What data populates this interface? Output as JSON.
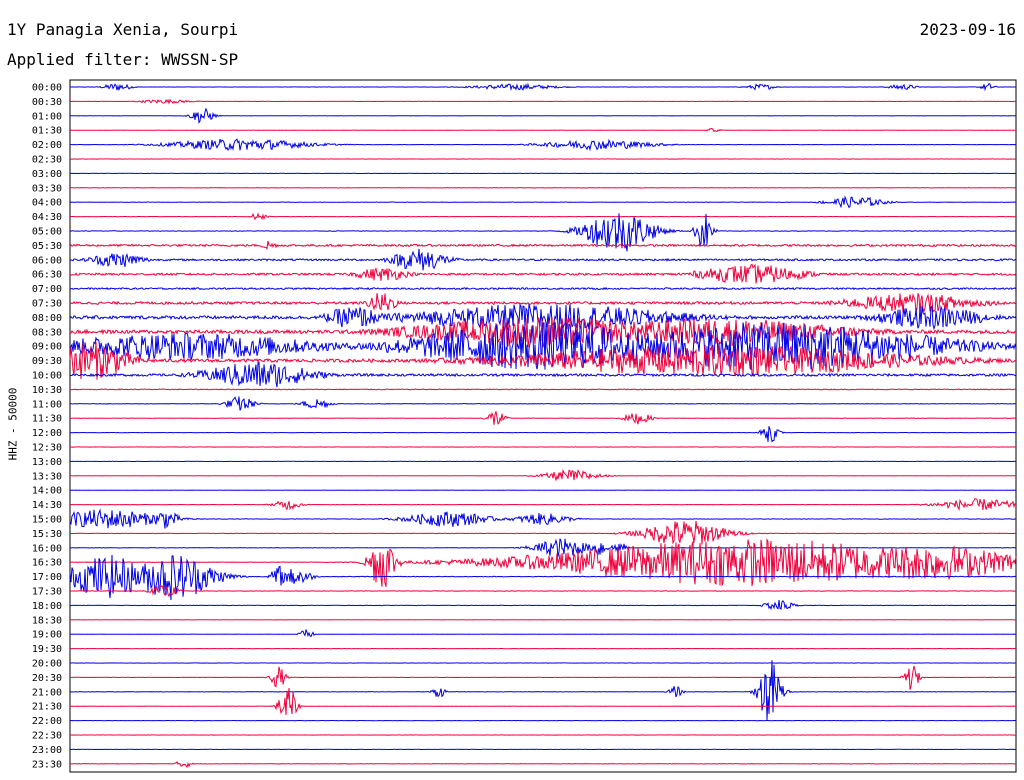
{
  "header": {
    "station": "1Y Panagia Xenia, Sourpi",
    "date": "2023-09-16",
    "filter": "Applied filter: WWSSN-SP"
  },
  "chart_data": {
    "type": "line",
    "subtype": "helicorder",
    "ylabel": "HHZ - 50000",
    "colors": [
      "#0000e6",
      "#f0003c"
    ],
    "row_labels": [
      "00:00",
      "00:30",
      "01:00",
      "01:30",
      "02:00",
      "02:30",
      "03:00",
      "03:30",
      "04:00",
      "04:30",
      "05:00",
      "05:30",
      "06:00",
      "06:30",
      "07:00",
      "07:30",
      "08:00",
      "08:30",
      "09:00",
      "09:30",
      "10:00",
      "10:30",
      "11:00",
      "11:30",
      "12:00",
      "12:30",
      "13:00",
      "13:30",
      "14:00",
      "14:30",
      "15:00",
      "15:30",
      "16:00",
      "16:30",
      "17:00",
      "17:30",
      "18:00",
      "18:30",
      "19:00",
      "19:30",
      "20:00",
      "20:30",
      "21:00",
      "21:30",
      "22:00",
      "22:30",
      "23:00",
      "23:30"
    ],
    "noise": [
      0.12,
      0.08,
      0.12,
      0.08,
      0.15,
      0.1,
      0.12,
      0.2,
      0.2,
      0.15,
      0.25,
      1.0,
      0.9,
      1.0,
      0.8,
      1.3,
      1.6,
      1.8,
      2.0,
      1.6,
      1.2,
      0.4,
      0.25,
      0.18,
      0.12,
      0.1,
      0.15,
      0.12,
      0.1,
      0.12,
      0.2,
      0.2,
      0.2,
      0.2,
      0.3,
      0.2,
      0.2,
      0.15,
      0.1,
      0.12,
      0.15,
      0.12,
      0.2,
      0.1,
      0.12,
      0.1,
      0.15,
      0.2
    ],
    "events": [
      {
        "row": 0,
        "x": 0.05,
        "amp": 4,
        "width": 0.01
      },
      {
        "row": 0,
        "x": 0.47,
        "amp": 3,
        "width": 0.03
      },
      {
        "row": 0,
        "x": 0.73,
        "amp": 3,
        "width": 0.01
      },
      {
        "row": 0,
        "x": 0.88,
        "amp": 3,
        "width": 0.01
      },
      {
        "row": 0,
        "x": 0.97,
        "amp": 4,
        "width": 0.005
      },
      {
        "row": 1,
        "x": 0.1,
        "amp": 2,
        "width": 0.02
      },
      {
        "row": 2,
        "x": 0.14,
        "amp": 8,
        "width": 0.008
      },
      {
        "row": 3,
        "x": 0.68,
        "amp": 2,
        "width": 0.005
      },
      {
        "row": 4,
        "x": 0.18,
        "amp": 6,
        "width": 0.05
      },
      {
        "row": 4,
        "x": 0.56,
        "amp": 5,
        "width": 0.04
      },
      {
        "row": 8,
        "x": 0.83,
        "amp": 6,
        "width": 0.02
      },
      {
        "row": 9,
        "x": 0.2,
        "amp": 6,
        "width": 0.005
      },
      {
        "row": 10,
        "x": 0.58,
        "amp": 22,
        "width": 0.025
      },
      {
        "row": 10,
        "x": 0.67,
        "amp": 20,
        "width": 0.006
      },
      {
        "row": 11,
        "x": 0.21,
        "amp": 6,
        "width": 0.005
      },
      {
        "row": 12,
        "x": 0.05,
        "amp": 8,
        "width": 0.02
      },
      {
        "row": 12,
        "x": 0.37,
        "amp": 12,
        "width": 0.02
      },
      {
        "row": 13,
        "x": 0.33,
        "amp": 7,
        "width": 0.02
      },
      {
        "row": 13,
        "x": 0.72,
        "amp": 10,
        "width": 0.04
      },
      {
        "row": 15,
        "x": 0.33,
        "amp": 12,
        "width": 0.01
      },
      {
        "row": 15,
        "x": 0.89,
        "amp": 10,
        "width": 0.05
      },
      {
        "row": 16,
        "x": 0.3,
        "amp": 12,
        "width": 0.02
      },
      {
        "row": 16,
        "x": 0.5,
        "amp": 14,
        "width": 0.1
      },
      {
        "row": 16,
        "x": 0.91,
        "amp": 12,
        "width": 0.04
      },
      {
        "row": 17,
        "x": 0.5,
        "amp": 16,
        "width": 0.1
      },
      {
        "row": 17,
        "x": 0.68,
        "amp": 14,
        "width": 0.1
      },
      {
        "row": 18,
        "x": 0.12,
        "amp": 14,
        "width": 0.1
      },
      {
        "row": 18,
        "x": 0.5,
        "amp": 25,
        "width": 0.1
      },
      {
        "row": 18,
        "x": 0.75,
        "amp": 25,
        "width": 0.12
      },
      {
        "row": 19,
        "x": 0.02,
        "amp": 20,
        "width": 0.03
      },
      {
        "row": 19,
        "x": 0.68,
        "amp": 16,
        "width": 0.15
      },
      {
        "row": 20,
        "x": 0.2,
        "amp": 14,
        "width": 0.04
      },
      {
        "row": 22,
        "x": 0.18,
        "amp": 8,
        "width": 0.01
      },
      {
        "row": 22,
        "x": 0.26,
        "amp": 6,
        "width": 0.01
      },
      {
        "row": 23,
        "x": 0.45,
        "amp": 10,
        "width": 0.006
      },
      {
        "row": 23,
        "x": 0.6,
        "amp": 6,
        "width": 0.01
      },
      {
        "row": 24,
        "x": 0.74,
        "amp": 10,
        "width": 0.006
      },
      {
        "row": 27,
        "x": 0.53,
        "amp": 6,
        "width": 0.02
      },
      {
        "row": 29,
        "x": 0.23,
        "amp": 5,
        "width": 0.01
      },
      {
        "row": 29,
        "x": 0.96,
        "amp": 6,
        "width": 0.03
      },
      {
        "row": 30,
        "x": 0.04,
        "amp": 10,
        "width": 0.04
      },
      {
        "row": 30,
        "x": 0.1,
        "amp": 10,
        "width": 0.01
      },
      {
        "row": 30,
        "x": 0.4,
        "amp": 8,
        "width": 0.03
      },
      {
        "row": 30,
        "x": 0.5,
        "amp": 6,
        "width": 0.02
      },
      {
        "row": 31,
        "x": 0.65,
        "amp": 14,
        "width": 0.03
      },
      {
        "row": 32,
        "x": 0.52,
        "amp": 10,
        "width": 0.02
      },
      {
        "row": 32,
        "x": 0.56,
        "amp": 10,
        "width": 0.005
      },
      {
        "row": 32,
        "x": 0.58,
        "amp": 8,
        "width": 0.005
      },
      {
        "row": 33,
        "x": 0.33,
        "amp": 28,
        "width": 0.01
      },
      {
        "row": 33,
        "x": 0.72,
        "amp": 24,
        "width": 0.15
      },
      {
        "row": 33,
        "x": 0.9,
        "amp": 18,
        "width": 0.08
      },
      {
        "row": 34,
        "x": 0.04,
        "amp": 22,
        "width": 0.03
      },
      {
        "row": 34,
        "x": 0.11,
        "amp": 24,
        "width": 0.03
      },
      {
        "row": 34,
        "x": 0.22,
        "amp": 12,
        "width": 0.005
      },
      {
        "row": 34,
        "x": 0.24,
        "amp": 10,
        "width": 0.01
      },
      {
        "row": 35,
        "x": 0.1,
        "amp": 6,
        "width": 0.01
      },
      {
        "row": 36,
        "x": 0.75,
        "amp": 6,
        "width": 0.01
      },
      {
        "row": 38,
        "x": 0.25,
        "amp": 5,
        "width": 0.005
      },
      {
        "row": 41,
        "x": 0.22,
        "amp": 12,
        "width": 0.005
      },
      {
        "row": 41,
        "x": 0.89,
        "amp": 14,
        "width": 0.005
      },
      {
        "row": 42,
        "x": 0.39,
        "amp": 6,
        "width": 0.005
      },
      {
        "row": 42,
        "x": 0.64,
        "amp": 6,
        "width": 0.005
      },
      {
        "row": 42,
        "x": 0.74,
        "amp": 35,
        "width": 0.008
      },
      {
        "row": 43,
        "x": 0.23,
        "amp": 22,
        "width": 0.006
      },
      {
        "row": 47,
        "x": 0.12,
        "amp": 5,
        "width": 0.005
      }
    ]
  }
}
